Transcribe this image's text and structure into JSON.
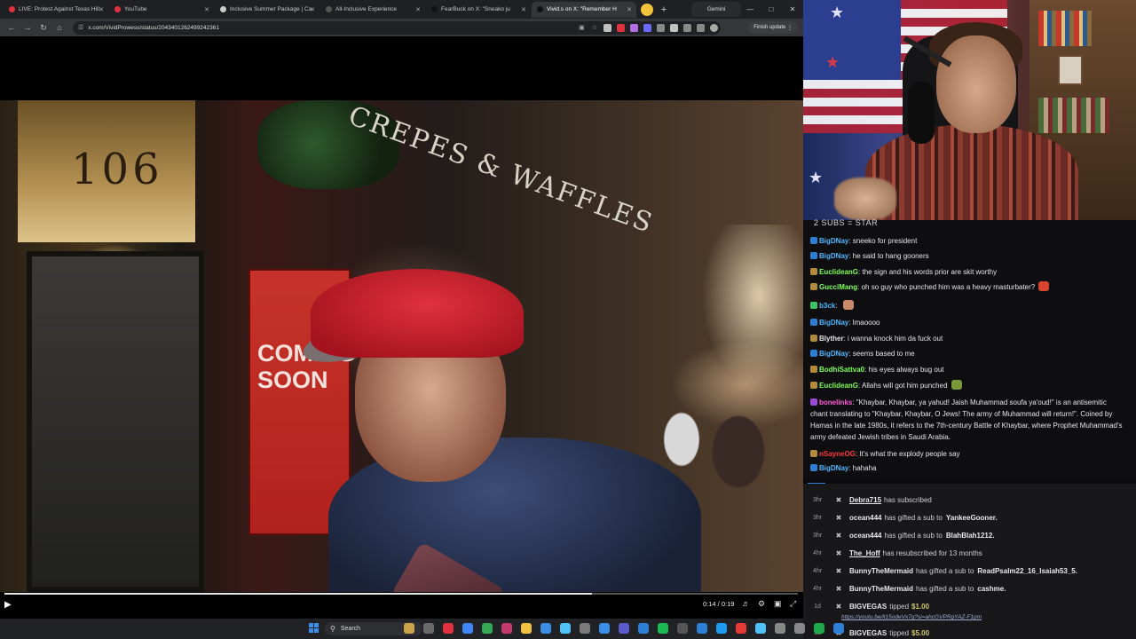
{
  "browser": {
    "tabs": [
      {
        "label": "LIVE: Protest Against Texas Hill",
        "fav": "#e0313e",
        "active": false
      },
      {
        "label": "YouTube",
        "fav": "#e0313e",
        "active": false
      },
      {
        "label": "Inclusive Summer Package | Ca",
        "fav": "#cccccc",
        "active": false
      },
      {
        "label": "All-Inclusive Experience",
        "fav": "#555555",
        "active": false
      },
      {
        "label": "FearBuck on X: \"Sneako ju",
        "fav": "#111111",
        "active": false
      },
      {
        "label": "Vivid.s on X: \"Remember H",
        "fav": "#111111",
        "active": true
      }
    ],
    "gemini_tab": "Gemini",
    "url": "x.com/VividProwess/status/2043401262499242361",
    "finish_update": "Finish update",
    "accent": "#35363a"
  },
  "video": {
    "sign_number": "106",
    "storefront_sign": "CREPES & WAFFLES",
    "poster_text": "COMING SOON",
    "time": "0:14 / 0:19",
    "progress": 0.74
  },
  "webcam": {
    "description_icons": [
      "flag-icon",
      "star-icon"
    ]
  },
  "chat": {
    "goal": "2 SUBS = STAR",
    "messages": [
      {
        "user": "BigDNay",
        "color": "#4fb7ff",
        "badge": "#2d7fd6",
        "text": "sneeko for president"
      },
      {
        "user": "BigDNay",
        "color": "#4fb7ff",
        "badge": "#2d7fd6",
        "text": "he said to hang gooners"
      },
      {
        "user": "EuclideanG",
        "color": "#7dff5a",
        "badge": "#b28a3a",
        "text": "the sign and his words prior are skit worthy"
      },
      {
        "user": "GucciMang",
        "color": "#7dff5a",
        "badge": "#b28a3a",
        "text": "oh so guy who punched him was a heavy masturbater?",
        "emote": "#d8442e"
      },
      {
        "user": "b3ck",
        "color": "#4fb7ff",
        "badge": "#39c46a",
        "text": "",
        "emote": "#c98a6a"
      },
      {
        "user": "BigDNay",
        "color": "#4fb7ff",
        "badge": "#2d7fd6",
        "text": "lmaoooo"
      },
      {
        "user": "Blyther",
        "color": "#e6e6e6",
        "badge": "#b28a3a",
        "text": "i wanna knock him da fuck out"
      },
      {
        "user": "BigDNay",
        "color": "#4fb7ff",
        "badge": "#2d7fd6",
        "text": "seems based to me"
      },
      {
        "user": "BodhiSattva0",
        "color": "#7dff5a",
        "badge": "#b28a3a",
        "text": "his eyes always bug out"
      },
      {
        "user": "EuclideanG",
        "color": "#7dff5a",
        "badge": "#b28a3a",
        "text": "Allahs will got him punched",
        "emote": "#7a9a3a"
      },
      {
        "user": "bonelinks",
        "color": "#ff5ad8",
        "badge": "#9a4ad6",
        "text": "\"Khaybar, Khaybar, ya yahud! Jaish Muhammad soufa ya'oud!\" is an antisemitic chant translating to \"Khaybar, Khaybar, O Jews! The army of Muhammad will return!\". Coined by Hamas in the late 1980s, it refers to the 7th-century Battle of Khaybar, where Prophet Muhammad's army defeated Jewish tribes in Saudi Arabia."
      },
      {
        "user": "nSayneOG",
        "color": "#ff3a3a",
        "badge": "#b28a3a",
        "text": "It's what the explody people say"
      },
      {
        "user": "BigDNay",
        "color": "#4fb7ff",
        "badge": "#2d7fd6",
        "text": "hahaha"
      }
    ]
  },
  "events": [
    {
      "time": "3hr",
      "user": "Debra715",
      "text": "has subscribed",
      "underline": true
    },
    {
      "time": "3hr",
      "user": "ocean444",
      "text": "has gifted a sub to",
      "target": "YankeeGooner."
    },
    {
      "time": "3hr",
      "user": "ocean444",
      "text": "has gifted a sub to",
      "target": "BlahBlah1212."
    },
    {
      "time": "4hr",
      "user": "The_Hoff",
      "text": "has resubscribed for 13 months",
      "underline": true
    },
    {
      "time": "4hr",
      "user": "BunnyTheMermaid",
      "text": "has gifted a sub to",
      "target": "ReadPsalm22_16_Isaiah53_5."
    },
    {
      "time": "4hr",
      "user": "BunnyTheMermaid",
      "text": "has gifted a sub to",
      "target": "cashme."
    },
    {
      "time": "1d",
      "user": "BIGVEGAS",
      "text": "tipped",
      "amount": "$1.00",
      "link": "https://youtu.be/lI15odeVx7g?si=ahcGVPRqYAZ-F1pm"
    },
    {
      "time": "1d",
      "user": "BIGVEGAS",
      "text": "tipped",
      "amount": "$5.00"
    }
  ],
  "taskbar": {
    "search_placeholder": "Search",
    "apps": [
      "#c9a24a",
      "#6a6a6a",
      "#e0313e",
      "#4285f4",
      "#34a853",
      "#c23a6a",
      "#f0c040",
      "#3a8ee6",
      "#4fc3f7",
      "#7a7a7a",
      "#3a8ee6",
      "#5a5acd",
      "#2d7fd6",
      "#1db954",
      "#555555",
      "#2d7fd6",
      "#1d9bf0",
      "#e53935",
      "#4fc3f7",
      "#888888",
      "#888888",
      "#1ea64a",
      "#2d7fd6"
    ]
  }
}
